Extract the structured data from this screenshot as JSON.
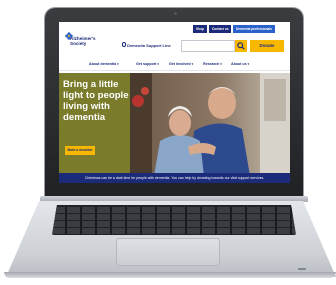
{
  "topbar": {
    "shop": "Shop",
    "contact": "Contact us",
    "pro": "Dementia professionals"
  },
  "logo": {
    "name": "Alzheimer's Society"
  },
  "header": {
    "support_line": "Dementia Support Line",
    "search_placeholder": "",
    "donate": "Donate"
  },
  "nav": {
    "items": [
      {
        "label": "About dementia"
      },
      {
        "label": "Get support"
      },
      {
        "label": "Get involved"
      },
      {
        "label": "Research"
      },
      {
        "label": "About us"
      }
    ]
  },
  "hero": {
    "title": "Bring a little light to people living with dementia",
    "cta": "Make a donation"
  },
  "caption": "Christmas can be a dark time for people with dementia. You can help by donating towards our vital support services.",
  "colors": {
    "brand_navy": "#1c2a7a",
    "accent_yellow": "#f8b800",
    "hero_olive": "#7a7c2c",
    "pro_blue": "#2a62c9"
  },
  "icons": [
    "forget-me-not-logo-icon",
    "phone-icon",
    "search-icon",
    "chevron-down-icon"
  ]
}
